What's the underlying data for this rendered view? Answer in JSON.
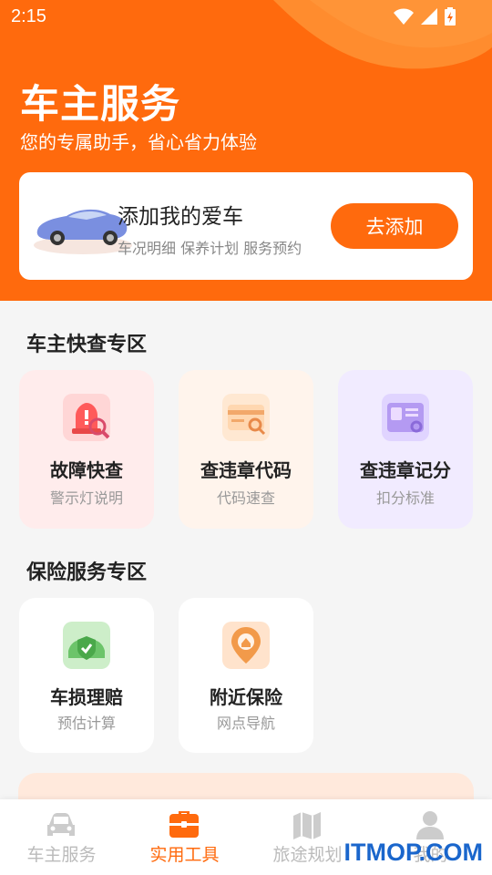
{
  "status_bar": {
    "time": "2:15"
  },
  "header": {
    "title": "车主服务",
    "subtitle": "您的专属助手，省心省力体验"
  },
  "car_card": {
    "title": "添加我的爱车",
    "subtitle": "车况明细 保养计划 服务预约",
    "button": "去添加"
  },
  "quick_section": {
    "title": "车主快查专区",
    "items": [
      {
        "name": "故障快查",
        "sub": "警示灯说明",
        "icon": "warning-light-icon",
        "bg": "#ffecec"
      },
      {
        "name": "查违章代码",
        "sub": "代码速查",
        "icon": "code-card-icon",
        "bg": "#fff4ec"
      },
      {
        "name": "查违章记分",
        "sub": "扣分标准",
        "icon": "license-card-icon",
        "bg": "#f1ebff"
      }
    ]
  },
  "insurance_section": {
    "title": "保险服务专区",
    "items": [
      {
        "name": "车损理赔",
        "sub": "预估计算",
        "icon": "car-shield-icon"
      },
      {
        "name": "附近保险",
        "sub": "网点导航",
        "icon": "location-pin-icon"
      }
    ]
  },
  "tabs": [
    {
      "label": "车主服务",
      "icon": "car-icon",
      "active": false
    },
    {
      "label": "实用工具",
      "icon": "toolbox-icon",
      "active": true
    },
    {
      "label": "旅途规划",
      "icon": "map-icon",
      "active": false
    },
    {
      "label": "我的",
      "icon": "user-icon",
      "active": false
    }
  ],
  "watermark": "ITMOP.COM",
  "colors": {
    "accent": "#ff6a0d",
    "background": "#f5f5f5"
  }
}
